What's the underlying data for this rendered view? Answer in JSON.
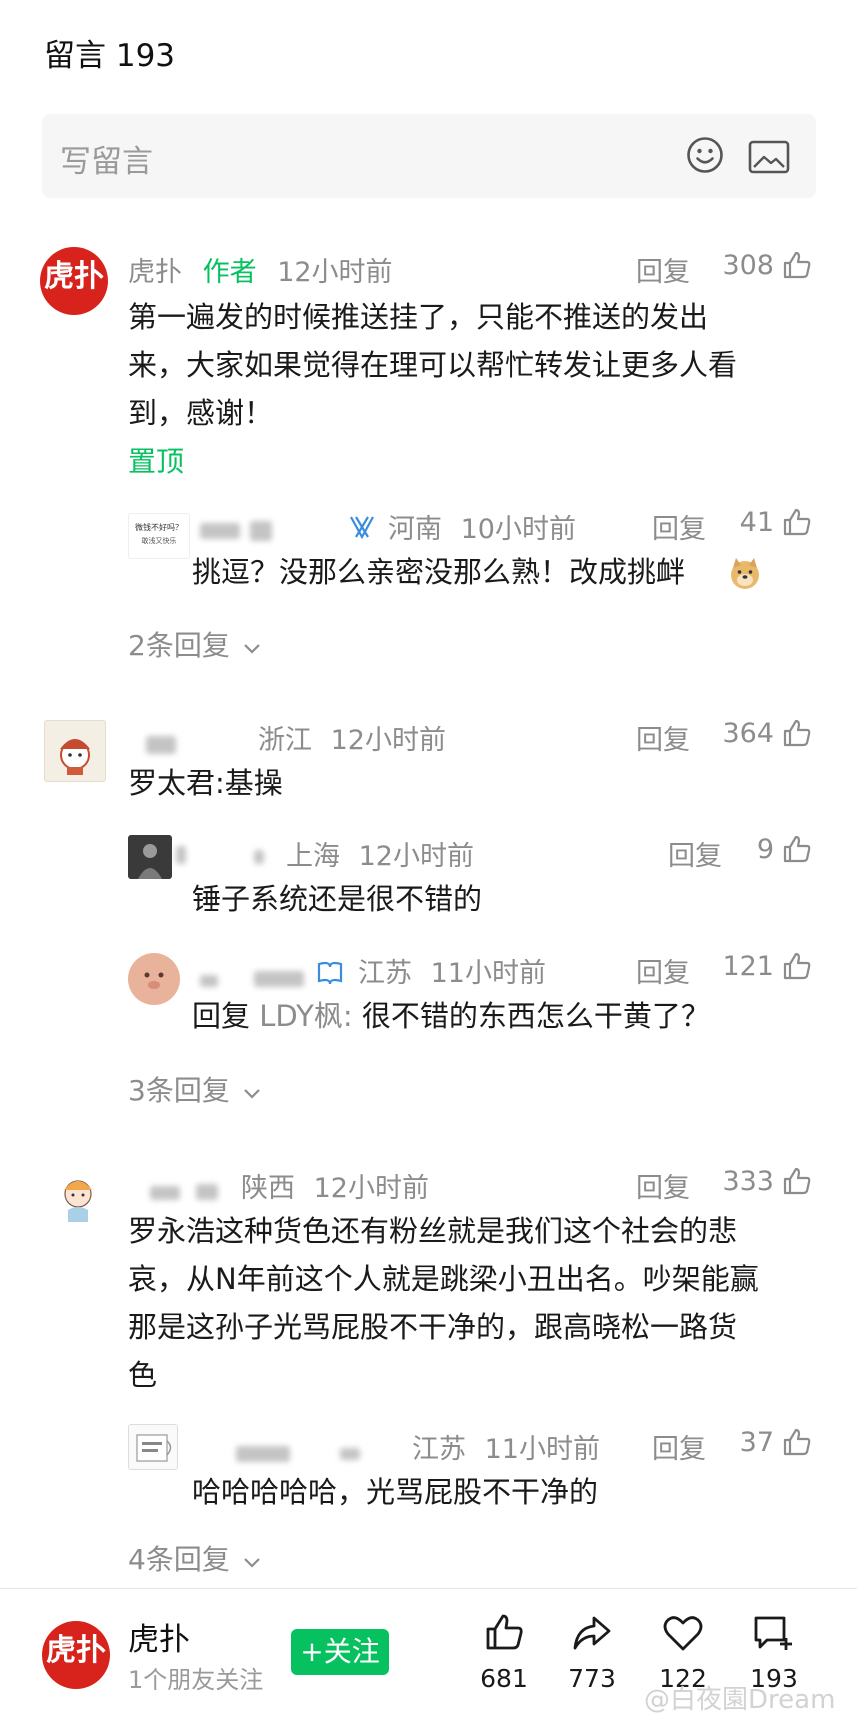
{
  "header": {
    "title": "留言 193"
  },
  "compose": {
    "placeholder": "写留言",
    "emoji_icon": "smiley-icon",
    "image_icon": "image-icon"
  },
  "reply_label": "回复",
  "comments": [
    {
      "name": "虎扑",
      "tag": "作者",
      "time": "12小时前",
      "likes": "308",
      "lines": [
        "第一遍发的时候推送挂了，只能不推送的发出",
        "来，大家如果觉得在理可以帮忙转发让更多人看",
        "到，感谢！"
      ],
      "pinned": "置顶",
      "replies": [
        {
          "avatar_text_1": "微钱不好吗？",
          "avatar_text_2": "敢浅又快乐",
          "location": "河南",
          "time": "10小时前",
          "likes": "41",
          "text": "挑逗？没那么亲密没那么熟！改成挑衅"
        }
      ],
      "more": "2条回复"
    },
    {
      "location": "浙江",
      "time": "12小时前",
      "likes": "364",
      "lines": [
        "罗太君:基操"
      ],
      "replies": [
        {
          "location": "上海",
          "time": "12小时前",
          "likes": "9",
          "text": "锤子系统还是很不错的"
        },
        {
          "location": "江苏",
          "time": "11小时前",
          "likes": "121",
          "text_prefix": "回复 ",
          "mention": "LDY枫:",
          "text": " 很不错的东西怎么干黄了？"
        }
      ],
      "more": "3条回复"
    },
    {
      "location": "陕西",
      "time": "12小时前",
      "likes": "333",
      "lines": [
        "罗永浩这种货色还有粉丝就是我们这个社会的悲",
        "哀，从N年前这个人就是跳梁小丑出名。吵架能赢",
        "那是这孙子光骂屁股不干净的，跟高晓松一路货",
        "色"
      ],
      "replies": [
        {
          "location": "江苏",
          "time": "11小时前",
          "likes": "37",
          "text": "哈哈哈哈哈，光骂屁股不干净的"
        }
      ],
      "more": "4条回复"
    }
  ],
  "bottom_bar": {
    "account_name": "虎扑",
    "friends": "1个朋友关注",
    "follow_label": "+关注",
    "likes": "681",
    "shares": "773",
    "favorites": "122",
    "comments": "193"
  },
  "watermark": "@白夜園Dream",
  "colors": {
    "accent_green": "#07c160",
    "hupu_red": "#d7231c",
    "meta_gray": "#8c8c8c"
  }
}
